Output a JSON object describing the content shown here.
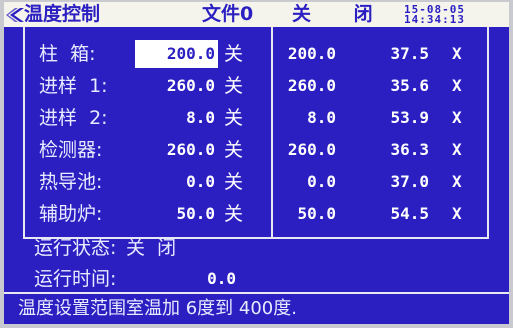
{
  "header": {
    "title": "温度控制",
    "file": "文件0",
    "status": "关 闭",
    "date": "15-08-05",
    "time": "14:34:13"
  },
  "channels": [
    {
      "label": "柱  箱:",
      "setpoint": "200.0",
      "unit": "关",
      "setpoint2": "200.0",
      "actual": "37.5",
      "flag": "X"
    },
    {
      "label": "进样  1:",
      "setpoint": "260.0",
      "unit": "关",
      "setpoint2": "260.0",
      "actual": "35.6",
      "flag": "X"
    },
    {
      "label": "进样  2:",
      "setpoint": "8.0",
      "unit": "关",
      "setpoint2": "8.0",
      "actual": "53.9",
      "flag": "X"
    },
    {
      "label": "检测器:",
      "setpoint": "260.0",
      "unit": "关",
      "setpoint2": "260.0",
      "actual": "36.3",
      "flag": "X"
    },
    {
      "label": "热导池:",
      "setpoint": "0.0",
      "unit": "关",
      "setpoint2": "0.0",
      "actual": "37.0",
      "flag": "X"
    },
    {
      "label": "辅助炉:",
      "setpoint": "50.0",
      "unit": "关",
      "setpoint2": "50.0",
      "actual": "54.5",
      "flag": "X"
    }
  ],
  "run_status": {
    "label": "运行状态:",
    "value": "关  闭"
  },
  "run_time": {
    "label": "运行时间:",
    "value": "0.0"
  },
  "footer": {
    "message": "温度设置范围室温加 6度到 400度."
  },
  "colors": {
    "background": "#2b1fc2",
    "text": "#ffffff",
    "header_bg": "#f4f4ec",
    "selection_bg": "#ffffff"
  }
}
